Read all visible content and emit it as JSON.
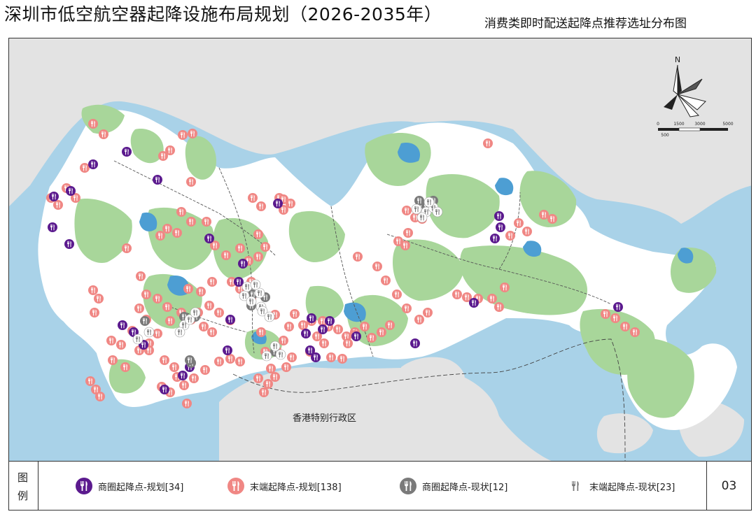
{
  "header": {
    "title": "深圳市低空航空器起降设施布局规划（2026-2035年）",
    "subtitle": "消费类即时配送起降点推荐选址分布图"
  },
  "map": {
    "region_label": "香港特别行政区",
    "scale_bar": {
      "ticks": [
        "0",
        "1500",
        "3000",
        "5000"
      ],
      "sub_tick": "500"
    },
    "north_label": "N",
    "colors": {
      "land": "#ffffff",
      "outer_land": "#e2e2e2",
      "sea": "#a9d2e8",
      "green": "#a8d69a",
      "reservoir": "#4d9ed3",
      "planned_business": "#5b1a8e",
      "planned_terminal": "#f08784",
      "existing_business": "#7a7a7a",
      "existing_terminal": "#ffffff"
    }
  },
  "legend": {
    "head_top": "图",
    "head_bottom": "例",
    "items": [
      {
        "label": "商圈起降点-规划[34]",
        "icon": "fork-knife-icon",
        "color": "#5b1a8e"
      },
      {
        "label": "末端起降点-规划[138]",
        "icon": "fork-knife-icon",
        "color": "#f08784"
      },
      {
        "label": "商圈起降点-现状[12]",
        "icon": "fork-knife-icon",
        "color": "#7a7a7a"
      },
      {
        "label": "末端起降点-现状[23]",
        "icon": "fork-knife-icon",
        "color": "#ffffff"
      }
    ],
    "page_no": "03"
  }
}
